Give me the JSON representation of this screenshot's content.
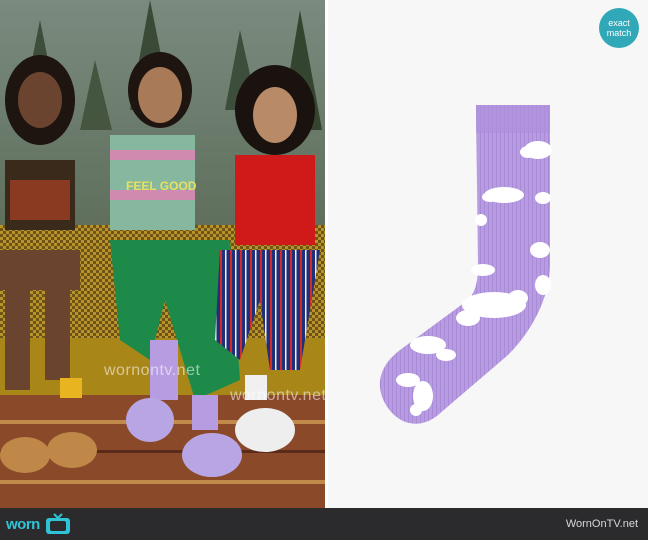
{
  "photo": {
    "watermarks": [
      "wornontv.net",
      "wornontv.net"
    ],
    "shirt_text": "FEEL GOOD"
  },
  "product": {
    "badge_line1": "exact",
    "badge_line2": "match"
  },
  "footer": {
    "logo_word": "worn",
    "credit": "WornOnTV.net"
  },
  "colors": {
    "sock_lavender": "#b89ce2",
    "badge_teal": "#30a8b8",
    "footer_bg": "#2b2b2e",
    "logo_cyan": "#2ec4d6"
  }
}
